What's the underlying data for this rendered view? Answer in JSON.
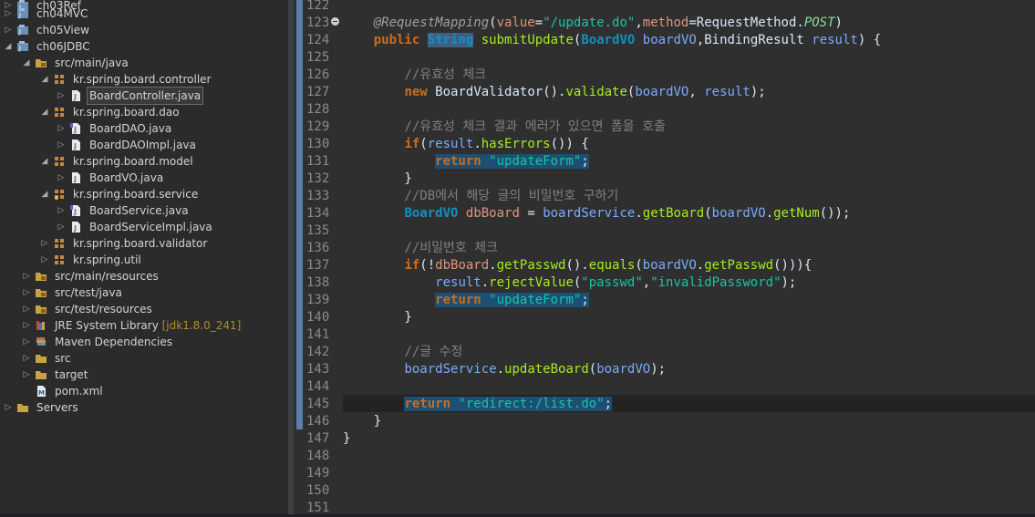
{
  "project_explorer": {
    "items": [
      {
        "label": "ch03Ref",
        "deco": ""
      },
      {
        "label": "ch04MVC",
        "deco": ""
      },
      {
        "label": "ch05View",
        "deco": ""
      },
      {
        "label": "ch06JDBC",
        "deco": ""
      },
      {
        "label": "src/main/java",
        "deco": ""
      },
      {
        "label": "kr.spring.board.controller",
        "deco": ""
      },
      {
        "label": "BoardController.java",
        "deco": ""
      },
      {
        "label": "kr.spring.board.dao",
        "deco": ""
      },
      {
        "label": "BoardDAO.java",
        "deco": ""
      },
      {
        "label": "BoardDAOImpl.java",
        "deco": ""
      },
      {
        "label": "kr.spring.board.model",
        "deco": ""
      },
      {
        "label": "BoardVO.java",
        "deco": ""
      },
      {
        "label": "kr.spring.board.service",
        "deco": ""
      },
      {
        "label": "BoardService.java",
        "deco": ""
      },
      {
        "label": "BoardServiceImpl.java",
        "deco": ""
      },
      {
        "label": "kr.spring.board.validator",
        "deco": ""
      },
      {
        "label": "kr.spring.util",
        "deco": ""
      },
      {
        "label": "src/main/resources",
        "deco": ""
      },
      {
        "label": "src/test/java",
        "deco": ""
      },
      {
        "label": "src/test/resources",
        "deco": ""
      },
      {
        "label": "JRE System Library",
        "deco": "[jdk1.8.0_241]"
      },
      {
        "label": "Maven Dependencies",
        "deco": ""
      },
      {
        "label": "src",
        "deco": ""
      },
      {
        "label": "target",
        "deco": ""
      },
      {
        "label": "pom.xml",
        "deco": ""
      },
      {
        "label": "Servers",
        "deco": ""
      }
    ]
  },
  "editor": {
    "line_numbers": [
      "122",
      "123",
      "124",
      "125",
      "126",
      "127",
      "128",
      "129",
      "130",
      "131",
      "132",
      "133",
      "134",
      "135",
      "136",
      "137",
      "138",
      "139",
      "140",
      "141",
      "142",
      "143",
      "144",
      "145",
      "146",
      "147",
      "148",
      "149",
      "150",
      "151"
    ],
    "lines": [
      [],
      [
        {
          "t": "    "
        },
        {
          "t": "@RequestMapping",
          "c": "ann"
        },
        {
          "t": "("
        },
        {
          "t": "value",
          "c": "field"
        },
        {
          "t": "="
        },
        {
          "t": "\"/update.do\"",
          "c": "str"
        },
        {
          "t": ","
        },
        {
          "t": "method",
          "c": "field"
        },
        {
          "t": "="
        },
        {
          "t": "RequestMethod",
          "c": "cls"
        },
        {
          "t": "."
        },
        {
          "t": "POST",
          "c": "const"
        },
        {
          "t": ")"
        }
      ],
      [
        {
          "t": "    "
        },
        {
          "t": "public",
          "c": "kw"
        },
        {
          "t": " "
        },
        {
          "t": "String",
          "c": "type hl"
        },
        {
          "t": " "
        },
        {
          "t": "submitUpdate",
          "c": "fn"
        },
        {
          "t": "("
        },
        {
          "t": "BoardVO",
          "c": "type"
        },
        {
          "t": " "
        },
        {
          "t": "boardVO",
          "c": "var"
        },
        {
          "t": ","
        },
        {
          "t": "BindingResult",
          "c": "cls"
        },
        {
          "t": " "
        },
        {
          "t": "result",
          "c": "var"
        },
        {
          "t": ") {"
        }
      ],
      [],
      [
        {
          "t": "        "
        },
        {
          "t": "//유효성 체크",
          "c": "cmt"
        }
      ],
      [
        {
          "t": "        "
        },
        {
          "t": "new",
          "c": "kw"
        },
        {
          "t": " "
        },
        {
          "t": "BoardValidator",
          "c": "cls"
        },
        {
          "t": "()."
        },
        {
          "t": "validate",
          "c": "fn"
        },
        {
          "t": "("
        },
        {
          "t": "boardVO",
          "c": "var"
        },
        {
          "t": ", "
        },
        {
          "t": "result",
          "c": "var"
        },
        {
          "t": ");"
        }
      ],
      [],
      [
        {
          "t": "        "
        },
        {
          "t": "//유효성 체크 결과 에러가 있으면 폼을 호출",
          "c": "cmt"
        }
      ],
      [
        {
          "t": "        "
        },
        {
          "t": "if",
          "c": "kw"
        },
        {
          "t": "("
        },
        {
          "t": "result",
          "c": "var"
        },
        {
          "t": "."
        },
        {
          "t": "hasErrors",
          "c": "fn"
        },
        {
          "t": "()) {"
        }
      ],
      [
        {
          "t": "            "
        },
        {
          "t": "return",
          "c": "kw sel"
        },
        {
          "t": " ",
          "c": "sel"
        },
        {
          "t": "\"updateForm\"",
          "c": "str sel"
        },
        {
          "t": ";",
          "c": "sel"
        }
      ],
      [
        {
          "t": "        }"
        }
      ],
      [
        {
          "t": "        "
        },
        {
          "t": "//DB에서 해당 글의 비밀번호 구하기",
          "c": "cmt"
        }
      ],
      [
        {
          "t": "        "
        },
        {
          "t": "BoardVO",
          "c": "type"
        },
        {
          "t": " "
        },
        {
          "t": "dbBoard",
          "c": "field"
        },
        {
          "t": " = "
        },
        {
          "t": "boardService",
          "c": "var"
        },
        {
          "t": "."
        },
        {
          "t": "getBoard",
          "c": "fn"
        },
        {
          "t": "("
        },
        {
          "t": "boardVO",
          "c": "var"
        },
        {
          "t": "."
        },
        {
          "t": "getNum",
          "c": "fn"
        },
        {
          "t": "());"
        }
      ],
      [],
      [
        {
          "t": "        "
        },
        {
          "t": "//비밀번호 체크",
          "c": "cmt"
        }
      ],
      [
        {
          "t": "        "
        },
        {
          "t": "if",
          "c": "kw"
        },
        {
          "t": "(!"
        },
        {
          "t": "dbBoard",
          "c": "field"
        },
        {
          "t": "."
        },
        {
          "t": "getPasswd",
          "c": "fn"
        },
        {
          "t": "()."
        },
        {
          "t": "equals",
          "c": "fn"
        },
        {
          "t": "("
        },
        {
          "t": "boardVO",
          "c": "var"
        },
        {
          "t": "."
        },
        {
          "t": "getPasswd",
          "c": "fn"
        },
        {
          "t": "())){"
        }
      ],
      [
        {
          "t": "            "
        },
        {
          "t": "result",
          "c": "var"
        },
        {
          "t": "."
        },
        {
          "t": "rejectValue",
          "c": "fn"
        },
        {
          "t": "("
        },
        {
          "t": "\"passwd\"",
          "c": "str"
        },
        {
          "t": ","
        },
        {
          "t": "\"invalidPassword\"",
          "c": "str"
        },
        {
          "t": ");"
        }
      ],
      [
        {
          "t": "            "
        },
        {
          "t": "return",
          "c": "kw sel"
        },
        {
          "t": " ",
          "c": "sel"
        },
        {
          "t": "\"updateForm\"",
          "c": "str sel"
        },
        {
          "t": ";",
          "c": "sel"
        }
      ],
      [
        {
          "t": "        }"
        }
      ],
      [],
      [
        {
          "t": "        "
        },
        {
          "t": "//글 수정",
          "c": "cmt"
        }
      ],
      [
        {
          "t": "        "
        },
        {
          "t": "boardService",
          "c": "var"
        },
        {
          "t": "."
        },
        {
          "t": "updateBoard",
          "c": "fn"
        },
        {
          "t": "("
        },
        {
          "t": "boardVO",
          "c": "var"
        },
        {
          "t": ");"
        }
      ],
      [],
      [
        {
          "t": "        "
        },
        {
          "t": "return",
          "c": "kw sel"
        },
        {
          "t": " ",
          "c": "sel"
        },
        {
          "t": "\"redirect:/list.do\"",
          "c": "str sel"
        },
        {
          "t": ";",
          "c": "sel"
        }
      ],
      [
        {
          "t": "    }"
        }
      ],
      [
        {
          "t": "}"
        }
      ],
      [],
      [],
      [],
      []
    ]
  },
  "colors": {
    "explorer_bg": "#2b2b2b",
    "editor_bg": "#2f2f2f",
    "selection": "#1d4f74",
    "keyword": "#cc6c1d",
    "string": "#17c6a3",
    "method": "#a7ec21",
    "variable": "#79abff",
    "comment": "#808080"
  }
}
